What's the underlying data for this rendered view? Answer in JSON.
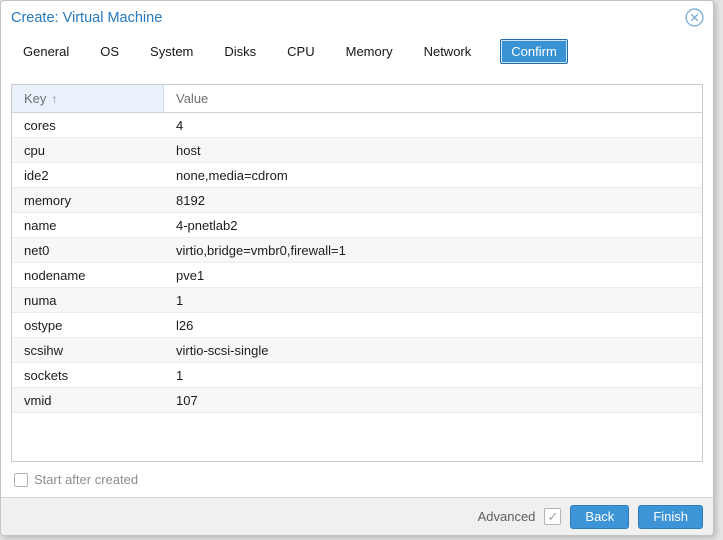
{
  "dialog": {
    "title": "Create: Virtual Machine"
  },
  "tabs": [
    {
      "label": "General",
      "active": false
    },
    {
      "label": "OS",
      "active": false
    },
    {
      "label": "System",
      "active": false
    },
    {
      "label": "Disks",
      "active": false
    },
    {
      "label": "CPU",
      "active": false
    },
    {
      "label": "Memory",
      "active": false
    },
    {
      "label": "Network",
      "active": false
    },
    {
      "label": "Confirm",
      "active": true
    }
  ],
  "table": {
    "columns": [
      {
        "label": "Key",
        "sorted": "asc",
        "sort_icon": "↑"
      },
      {
        "label": "Value"
      }
    ],
    "rows": [
      {
        "key": "cores",
        "value": "4"
      },
      {
        "key": "cpu",
        "value": "host"
      },
      {
        "key": "ide2",
        "value": "none,media=cdrom"
      },
      {
        "key": "memory",
        "value": "8192"
      },
      {
        "key": "name",
        "value": "4-pnetlab2"
      },
      {
        "key": "net0",
        "value": "virtio,bridge=vmbr0,firewall=1"
      },
      {
        "key": "nodename",
        "value": "pve1"
      },
      {
        "key": "numa",
        "value": "1"
      },
      {
        "key": "ostype",
        "value": "l26"
      },
      {
        "key": "scsihw",
        "value": "virtio-scsi-single"
      },
      {
        "key": "sockets",
        "value": "1"
      },
      {
        "key": "vmid",
        "value": "107"
      }
    ]
  },
  "options": {
    "start_after_created": {
      "label": "Start after created",
      "checked": false
    }
  },
  "footer": {
    "advanced": {
      "label": "Advanced",
      "checked": true,
      "check_glyph": "✓"
    },
    "back_label": "Back",
    "finish_label": "Finish"
  },
  "colors": {
    "accent": "#3892d4",
    "title": "#2579bd",
    "header_cell_bg": "#e9f1fb",
    "stripe": "#f7f7f7",
    "footer_bg": "#f0f0f0"
  }
}
